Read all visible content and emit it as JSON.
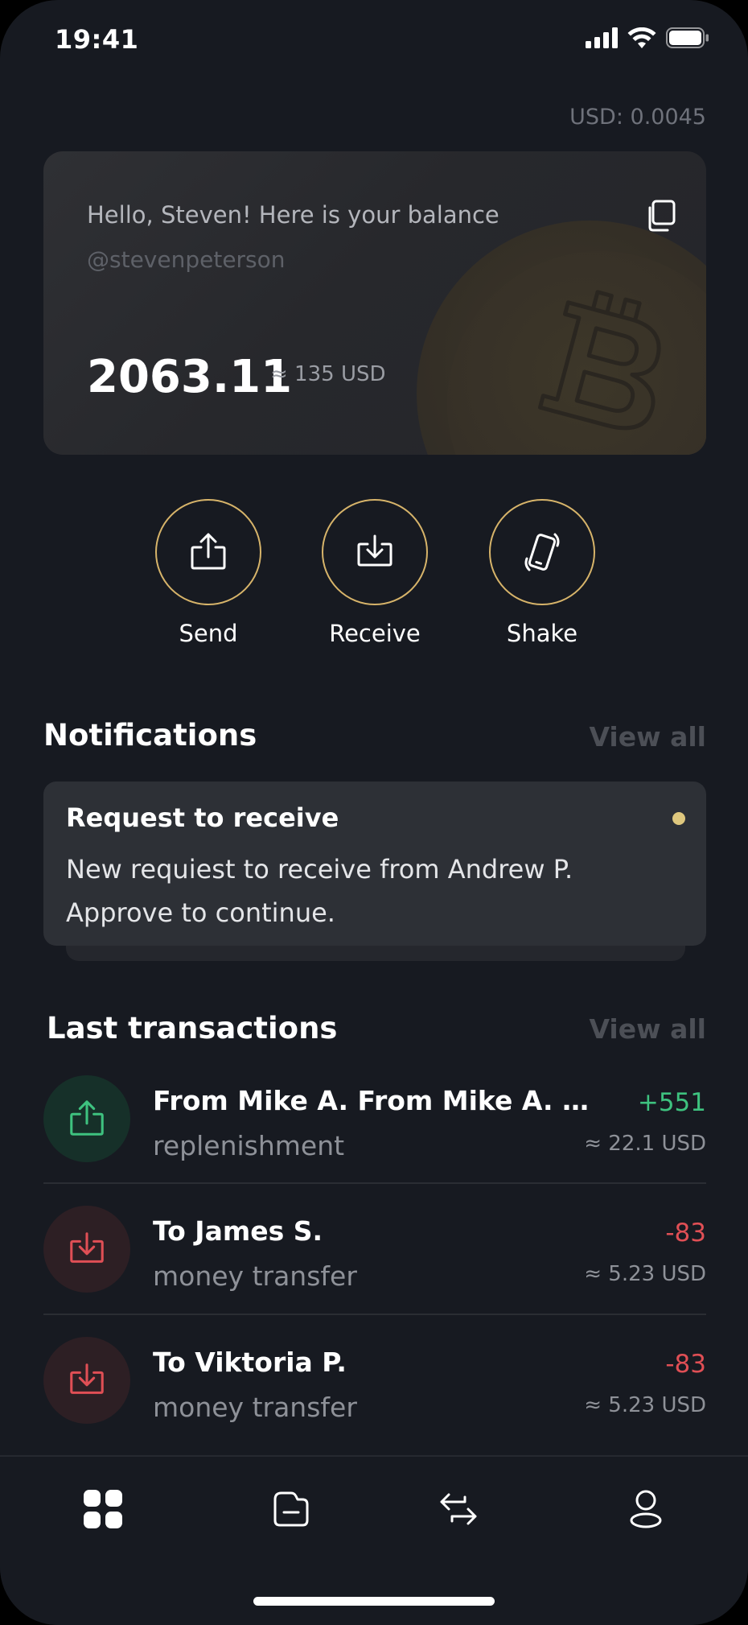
{
  "status_bar": {
    "time": "19:41",
    "icons": [
      "signal-icon",
      "wifi-icon",
      "battery-icon"
    ]
  },
  "header": {
    "usd_rate": "USD: 0.0045"
  },
  "balance_card": {
    "greeting": "Hello, Steven! Here is your balance",
    "username": "@stevenpeterson",
    "amount": "2063.11",
    "usd_equivalent": "≈ 135 USD",
    "copy_icon": "copy-icon",
    "coin_icon": "bitcoin-icon"
  },
  "actions": [
    {
      "label": "Send",
      "icon": "upload-icon"
    },
    {
      "label": "Receive",
      "icon": "download-icon"
    },
    {
      "label": "Shake",
      "icon": "shake-phone-icon"
    }
  ],
  "notifications": {
    "title": "Notifications",
    "view_all": "View all",
    "items": [
      {
        "title": "Request to receive",
        "text": "New requiest to receive from Andrew P. Approve to continue.",
        "unread": true
      }
    ]
  },
  "transactions": {
    "title": "Last transactions",
    "view_all": "View all",
    "items": [
      {
        "name": "From Mike A. From Mike A. From Mike A.",
        "type": "replenishment",
        "amount": "+551",
        "usd": "≈ 22.1 USD",
        "direction": "in"
      },
      {
        "name": "To James S.",
        "type": "money transfer",
        "amount": "-83",
        "usd": "≈ 5.23 USD",
        "direction": "out"
      },
      {
        "name": "To Viktoria P.",
        "type": "money transfer",
        "amount": "-83",
        "usd": "≈ 5.23 USD",
        "direction": "out"
      }
    ]
  },
  "bottom_nav": {
    "items": [
      {
        "icon": "dashboard-icon",
        "active": true
      },
      {
        "icon": "wallet-icon",
        "active": false
      },
      {
        "icon": "exchange-icon",
        "active": false
      },
      {
        "icon": "profile-icon",
        "active": false
      }
    ]
  },
  "colors": {
    "background": "#171A21",
    "accent_gold": "#D7B46A",
    "positive": "#3EC27F",
    "negative": "#E04F55",
    "muted_text": "#8E9198"
  }
}
